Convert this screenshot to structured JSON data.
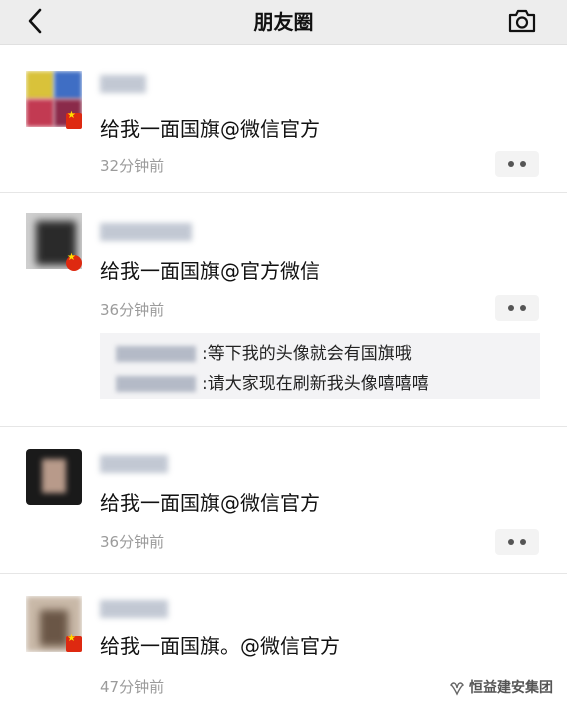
{
  "header": {
    "title": "朋友圈",
    "back_icon": "chevron-left-icon",
    "camera_icon": "camera-icon"
  },
  "posts": [
    {
      "text": "给我一面国旗@微信官方",
      "time": "32分钟前",
      "flag_badge": true
    },
    {
      "text": "给我一面国旗@官方微信",
      "time": "36分钟前",
      "flag_badge": true,
      "comments": [
        {
          "separator": ":",
          "text": "等下我的头像就会有国旗哦"
        },
        {
          "separator": ":",
          "text": "请大家现在刷新我头像嘻嘻嘻"
        }
      ]
    },
    {
      "text": "给我一面国旗@微信官方",
      "time": "36分钟前",
      "flag_badge": false
    },
    {
      "text": "给我一面国旗。@微信官方",
      "time": "47分钟前",
      "flag_badge": true
    }
  ],
  "watermark": {
    "text": "恒益建安集团",
    "icon": "wechat-channel-icon"
  },
  "colors": {
    "header_bg": "#ededed",
    "timestamp": "#9b9b9b",
    "comment_bg": "#f3f3f5",
    "flag_red": "#de2910",
    "flag_star": "#ffde00"
  }
}
